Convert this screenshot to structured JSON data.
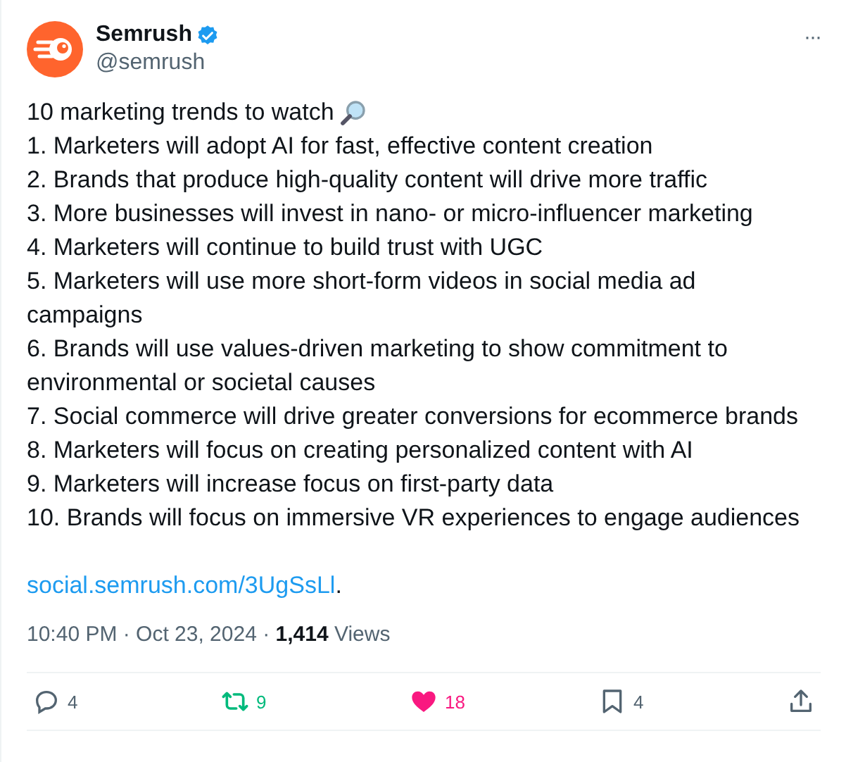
{
  "author": {
    "name": "Semrush",
    "verified": true,
    "handle": "@semrush"
  },
  "menu": {
    "label": "···"
  },
  "body": {
    "headline": "10 marketing trends to watch",
    "lines": [
      "1. Marketers will adopt AI for fast, effective content creation",
      "2. Brands that produce high-quality content will drive more traffic",
      "3. More businesses will invest in nano- or micro-influencer marketing",
      "4. Marketers will continue to build trust with UGC",
      "5. Marketers will use more short-form videos in social media ad campaigns",
      "6. Brands will use values-driven marketing to show commitment to environmental or societal causes",
      "7. Social commerce will drive greater conversions for ecommerce brands",
      "8. Marketers will focus on creating personalized content with AI",
      "9. Marketers will increase focus on first-party data",
      "10. Brands will focus on immersive VR experiences to engage audiences"
    ],
    "link": "social.semrush.com/3UgSsLl",
    "link_suffix": "."
  },
  "meta": "10:40 PM · Oct 23, 2024 · **1,414** Views",
  "actions": [
    {
      "kind": "reply",
      "count": "4",
      "on": false
    },
    {
      "kind": "repost",
      "count": "9",
      "on": true
    },
    {
      "kind": "like",
      "count": "18",
      "on": true
    },
    {
      "kind": "bookmark",
      "count": "4",
      "on": false
    },
    {
      "kind": "share",
      "on": false
    }
  ]
}
